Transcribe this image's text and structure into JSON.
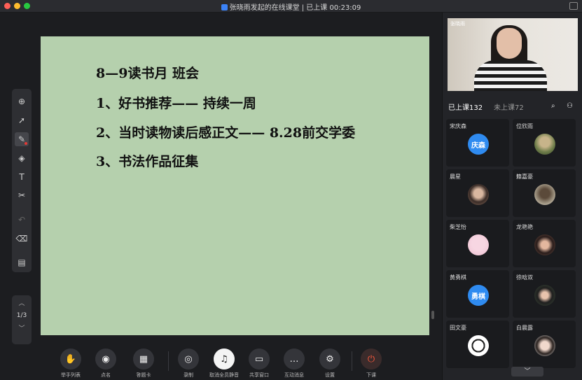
{
  "window": {
    "title": "张晓雨发起的在线课堂 | 已上课 00:23:09",
    "lights": [
      "#fe5f57",
      "#febc2e",
      "#28c840"
    ]
  },
  "slide": {
    "lines": [
      "8—9读书月  班会",
      "1、好书推荐—— 持续一周",
      "2、当时读物读后感正文—— 8.28前交学委",
      "3、书法作品征集"
    ],
    "background": "#b5d0ad"
  },
  "toolbar": {
    "tools": [
      {
        "name": "add-page-icon",
        "glyph": "⊕"
      },
      {
        "name": "pointer-icon",
        "glyph": "➚"
      },
      {
        "name": "pen-icon",
        "glyph": "✎"
      },
      {
        "name": "shapes-icon",
        "glyph": "◈"
      },
      {
        "name": "text-icon",
        "glyph": "T"
      },
      {
        "name": "scissors-icon",
        "glyph": "✂"
      },
      {
        "name": "undo-icon",
        "glyph": "↶"
      },
      {
        "name": "eraser-icon",
        "glyph": "⌫"
      },
      {
        "name": "toolbox-icon",
        "glyph": "▤"
      }
    ]
  },
  "pager": {
    "label": "1/3"
  },
  "bottom_bar": {
    "buttons": [
      {
        "label": "举手列表",
        "icon": "hand-icon",
        "glyph": "✋"
      },
      {
        "label": "点名",
        "icon": "location-icon",
        "glyph": "◉"
      },
      {
        "label": "答题卡",
        "icon": "answer-card-icon",
        "glyph": "▦"
      },
      {
        "label": "录制",
        "icon": "record-icon",
        "glyph": "◎"
      },
      {
        "label": "取消全员静音",
        "icon": "mute-all-icon",
        "glyph": "♫"
      },
      {
        "label": "共享窗口",
        "icon": "share-window-icon",
        "glyph": "▭"
      },
      {
        "label": "互动消息",
        "icon": "message-icon",
        "glyph": "…"
      },
      {
        "label": "设置",
        "icon": "gear-icon",
        "glyph": "⚙"
      },
      {
        "label": "下课",
        "icon": "power-icon",
        "glyph": "⏻"
      }
    ]
  },
  "panel": {
    "teacher_name": "张晓雨",
    "tab_attended": "已上课132",
    "tab_absent": "未上课72",
    "students": [
      {
        "name": "宋庆森",
        "avatar_text": "庆森"
      },
      {
        "name": "位欣雨",
        "avatar_text": ""
      },
      {
        "name": "晨星",
        "avatar_text": ""
      },
      {
        "name": "籍嘉豪",
        "avatar_text": ""
      },
      {
        "name": "柴芝怡",
        "avatar_text": ""
      },
      {
        "name": "龙艳艳",
        "avatar_text": ""
      },
      {
        "name": "黄勇棋",
        "avatar_text": "勇棋"
      },
      {
        "name": "徐晗双",
        "avatar_text": ""
      },
      {
        "name": "田文豪",
        "avatar_text": ""
      },
      {
        "name": "白晨露",
        "avatar_text": ""
      }
    ]
  }
}
